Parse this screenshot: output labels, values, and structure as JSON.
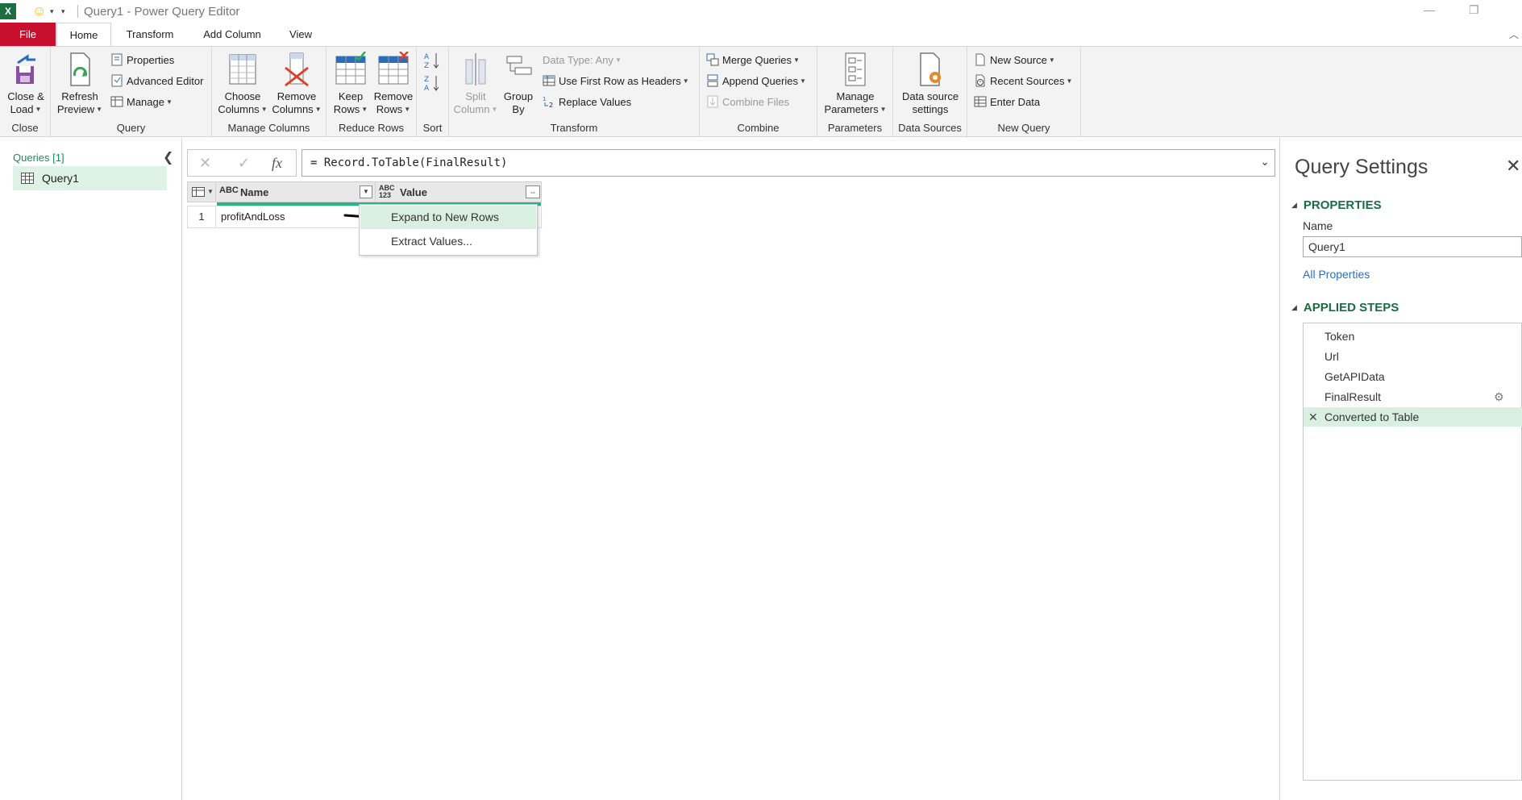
{
  "window": {
    "title": "Query1 - Power Query Editor",
    "app_logo": "X",
    "restore_glyph": "❐"
  },
  "tabs": [
    {
      "label": "File"
    },
    {
      "label": "Home"
    },
    {
      "label": "Transform"
    },
    {
      "label": "Add Column"
    },
    {
      "label": "View"
    }
  ],
  "ribbon": {
    "close": {
      "group": "Close",
      "close_load_1": "Close &",
      "close_load_2": "Load"
    },
    "query": {
      "group": "Query",
      "refresh_1": "Refresh",
      "refresh_2": "Preview",
      "properties": "Properties",
      "advanced_editor": "Advanced Editor",
      "manage": "Manage"
    },
    "manage_columns": {
      "group": "Manage Columns",
      "choose_1": "Choose",
      "choose_2": "Columns",
      "remove_1": "Remove",
      "remove_2": "Columns"
    },
    "reduce_rows": {
      "group": "Reduce Rows",
      "keep_1": "Keep",
      "keep_2": "Rows",
      "remove_1": "Remove",
      "remove_2": "Rows"
    },
    "sort": {
      "group": "Sort"
    },
    "transform": {
      "group": "Transform",
      "split_1": "Split",
      "split_2": "Column",
      "group_by_1": "Group",
      "group_by_2": "By",
      "data_type": "Data Type: Any",
      "first_row_headers": "Use First Row as Headers",
      "replace_values": "Replace Values"
    },
    "combine": {
      "group": "Combine",
      "merge": "Merge Queries",
      "append": "Append Queries",
      "combine_files": "Combine Files"
    },
    "parameters": {
      "group": "Parameters",
      "manage_1": "Manage",
      "manage_2": "Parameters"
    },
    "data_sources": {
      "group": "Data Sources",
      "settings_1": "Data source",
      "settings_2": "settings"
    },
    "new_query": {
      "group": "New Query",
      "new_source": "New Source",
      "recent_sources": "Recent Sources",
      "enter_data": "Enter Data"
    }
  },
  "queries_pane": {
    "title": "Queries [1]",
    "items": [
      {
        "label": "Query1"
      }
    ]
  },
  "formula_bar": {
    "cancel_glyph": "✕",
    "commit_glyph": "✓",
    "fx_label": "fx",
    "formula": "= Record.ToTable(FinalResult)"
  },
  "grid": {
    "columns": [
      {
        "type_label": "ABC",
        "name": "Name"
      },
      {
        "type_label": "ABC 123",
        "name": "Value"
      }
    ],
    "rows": [
      {
        "index": "1",
        "name": "profitAndLoss",
        "value": ""
      }
    ]
  },
  "context_menu": {
    "items": [
      {
        "label": "Expand to New Rows",
        "highlighted": true
      },
      {
        "label": "Extract Values...",
        "highlighted": false
      }
    ]
  },
  "query_settings": {
    "title": "Query Settings",
    "properties_header": "PROPERTIES",
    "name_label": "Name",
    "name_value": "Query1",
    "all_properties": "All Properties",
    "applied_steps_header": "APPLIED STEPS",
    "steps": [
      {
        "label": "Token"
      },
      {
        "label": "Url"
      },
      {
        "label": "GetAPIData"
      },
      {
        "label": "FinalResult"
      },
      {
        "label": "Converted to Table"
      }
    ]
  },
  "colors": {
    "file_tab": "#c8102e",
    "accent_green": "#1b6b45",
    "selection_bg": "#d8efe1",
    "column_bar": "#2ab38a"
  }
}
